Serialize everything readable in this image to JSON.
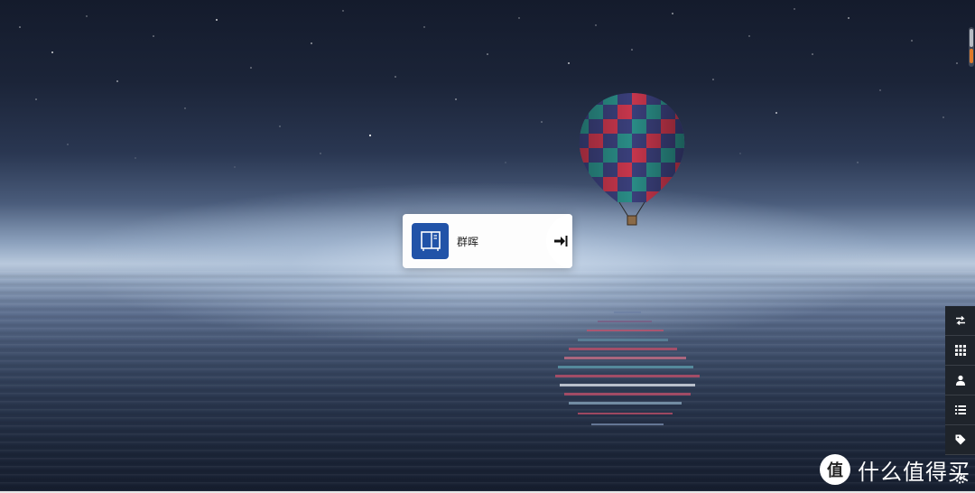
{
  "launcher": {
    "app_name": "群晖",
    "app_icon": "nas-server-icon",
    "enter_icon": "arrow-right-to-bar-icon",
    "tile_color": "#2153a8"
  },
  "toolbar": {
    "items": [
      {
        "icon": "swap-arrows-icon"
      },
      {
        "icon": "grid-icon"
      },
      {
        "icon": "user-icon"
      },
      {
        "icon": "list-icon"
      },
      {
        "icon": "tag-icon"
      }
    ]
  },
  "watermark": {
    "text": "什么值得买",
    "logo_char": "值"
  },
  "scrollbar": {
    "accent_color": "#e07a2b"
  }
}
